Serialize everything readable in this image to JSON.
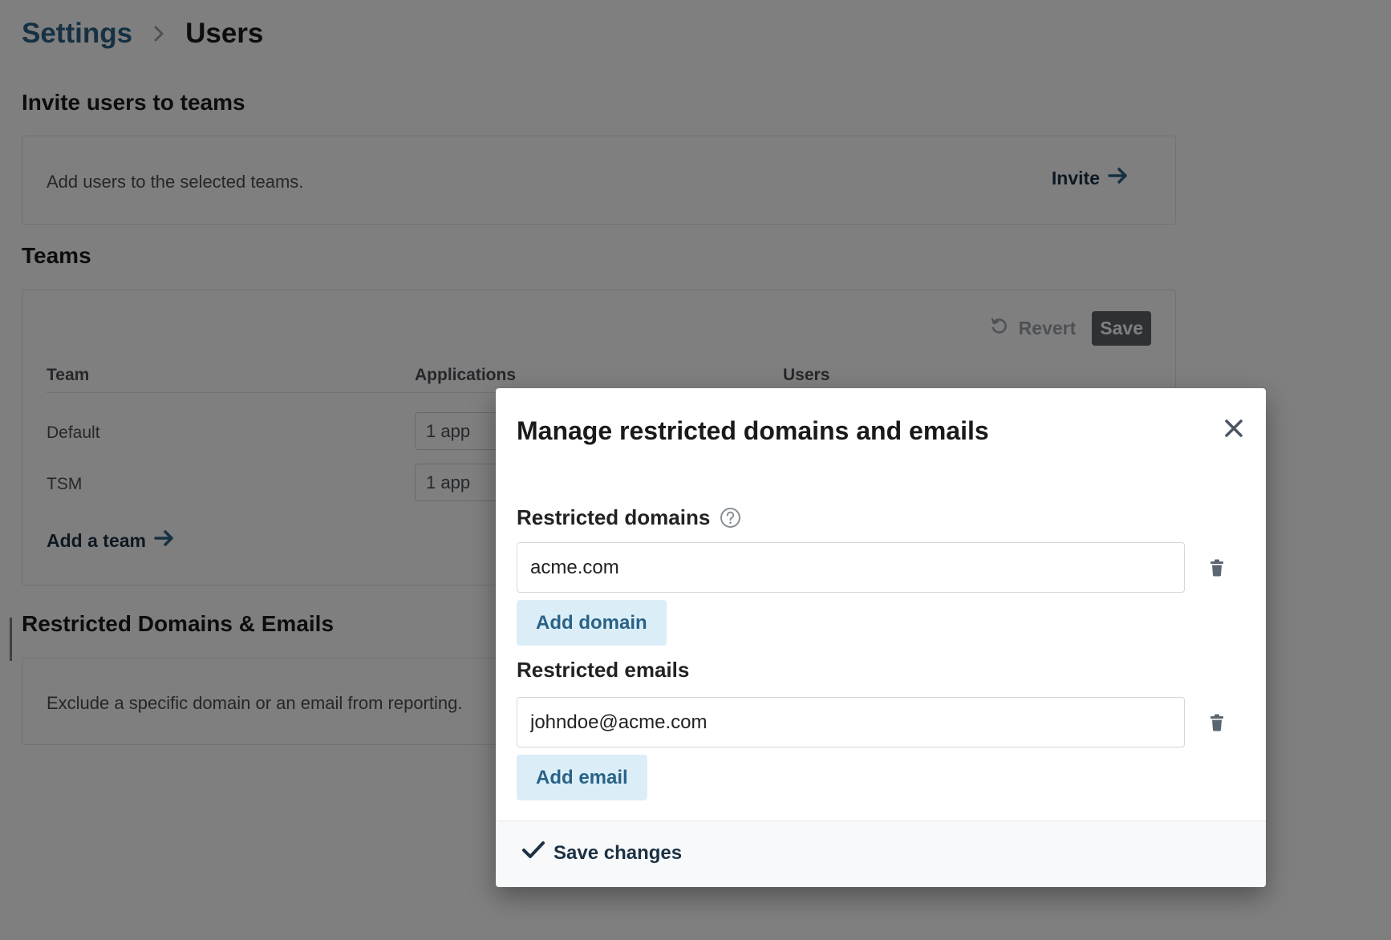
{
  "breadcrumb": {
    "parent": "Settings",
    "current": "Users"
  },
  "invite_section": {
    "title": "Invite users to teams",
    "description": "Add users to the selected teams.",
    "invite_label": "Invite"
  },
  "teams_section": {
    "title": "Teams",
    "revert_label": "Revert",
    "save_label": "Save",
    "columns": [
      "Team",
      "Applications",
      "Users"
    ],
    "rows": [
      {
        "team": "Default",
        "applications": "1 app"
      },
      {
        "team": "TSM",
        "applications": "1 app"
      }
    ],
    "add_team_label": "Add a team"
  },
  "restricted_section": {
    "title": "Restricted Domains & Emails",
    "description": "Exclude a specific domain or an email from reporting."
  },
  "modal": {
    "title": "Manage restricted domains and emails",
    "domains_label": "Restricted domains",
    "domain_value": "acme.com",
    "add_domain_label": "Add domain",
    "emails_label": "Restricted emails",
    "email_value": "johndoe@acme.com",
    "add_email_label": "Add email",
    "save_changes_label": "Save changes"
  },
  "icons": {
    "breadcrumb_separator": "chevron-right-icon",
    "invite": "arrow-right-icon",
    "revert": "undo-icon",
    "close": "close-icon",
    "help": "question-circle-icon",
    "delete": "trash-icon",
    "save": "checkmark-icon"
  },
  "colors": {
    "link_blue": "#2a6287",
    "dark_navy": "#1c3144",
    "add_button_bg": "#dbeef8",
    "save_button_bg": "#5a6268"
  }
}
